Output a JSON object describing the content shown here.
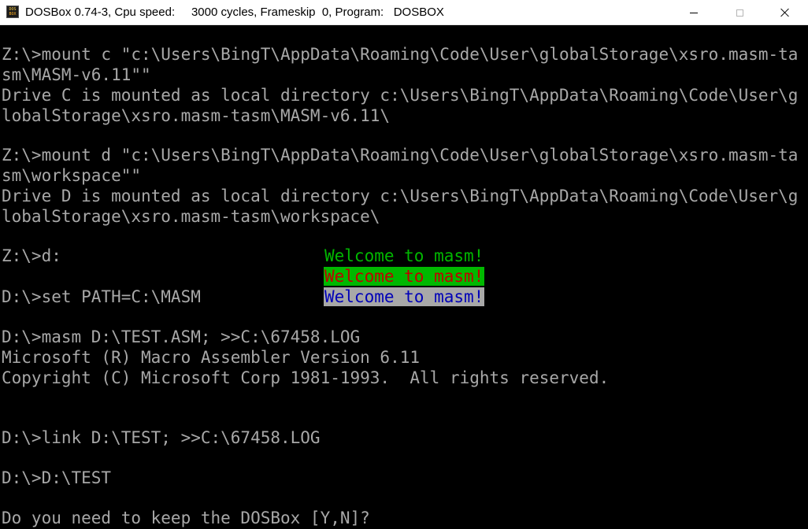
{
  "window": {
    "title": "DOSBox 0.74-3, Cpu speed:     3000 cycles, Frameskip  0, Program:   DOSBOX",
    "icon_lines": [
      "DOS",
      "BOX"
    ],
    "icon": "dosbox-app-icon",
    "controls": {
      "minimize": "minimize-icon",
      "maximize": "maximize-icon",
      "close": "close-icon"
    }
  },
  "console": {
    "text_color": "#a8a8a8",
    "background": "#000000",
    "lines": [
      "Z:\\>mount c \"c:\\Users\\BingT\\AppData\\Roaming\\Code\\User\\globalStorage\\xsro.masm-ta",
      "sm\\MASM-v6.11\"\"",
      "Drive C is mounted as local directory c:\\Users\\BingT\\AppData\\Roaming\\Code\\User\\g",
      "lobalStorage\\xsro.masm-tasm\\MASM-v6.11\\",
      "",
      "Z:\\>mount d \"c:\\Users\\BingT\\AppData\\Roaming\\Code\\User\\globalStorage\\xsro.masm-ta",
      "sm\\workspace\"\"",
      "Drive D is mounted as local directory c:\\Users\\BingT\\AppData\\Roaming\\Code\\User\\g",
      "lobalStorage\\xsro.masm-tasm\\workspace\\",
      "",
      "Z:\\>d:",
      "",
      "D:\\>set PATH=C:\\MASM",
      "",
      "D:\\>masm D:\\TEST.ASM; >>C:\\67458.LOG",
      "Microsoft (R) Macro Assembler Version 6.11",
      "Copyright (C) Microsoft Corp 1981-1993.  All rights reserved.",
      "",
      "",
      "D:\\>link D:\\TEST; >>C:\\67458.LOG",
      "",
      "D:\\>D:\\TEST",
      "",
      "Do you need to keep the DOSBox [Y,N]?"
    ],
    "welcome": [
      {
        "text": "Welcome to masm!",
        "fg": "#00b800",
        "bg": "#000000"
      },
      {
        "text": "Welcome to masm!",
        "fg": "#c00000",
        "bg": "#00b800"
      },
      {
        "text": "Welcome to masm!",
        "fg": "#0000b8",
        "bg": "#a8a8a8"
      }
    ]
  }
}
